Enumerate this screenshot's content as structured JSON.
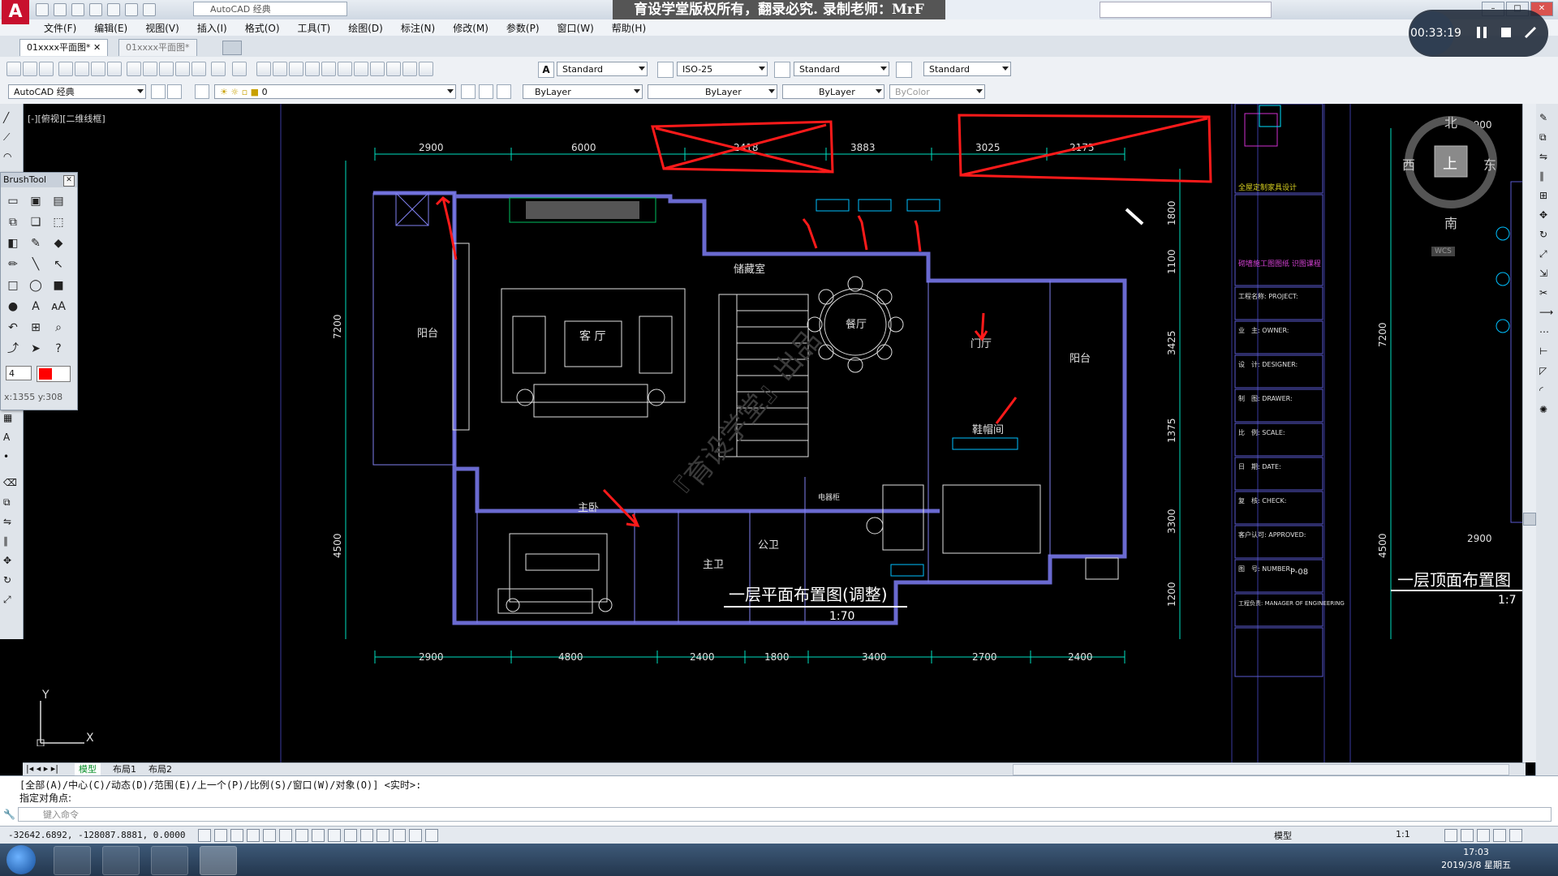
{
  "app": {
    "title_combo": "AutoCAD 经典",
    "banner": "育设学堂版权所有，翻录必究. 录制老师：MrF"
  },
  "menu": [
    "文件(F)",
    "编辑(E)",
    "视图(V)",
    "插入(I)",
    "格式(O)",
    "工具(T)",
    "绘图(D)",
    "标注(N)",
    "修改(M)",
    "参数(P)",
    "窗口(W)",
    "帮助(H)"
  ],
  "tabs": [
    "01xxxx平面图*",
    "01xxxx平面图*"
  ],
  "toolbar": {
    "text_style": "Standard",
    "dim_style": "ISO-25",
    "table_style": "Standard",
    "multileader_style": "Standard",
    "workspace": "AutoCAD 经典",
    "layer": "0",
    "color": "ByLayer",
    "linetype": "ByLayer",
    "lineweight": "ByLayer",
    "plotstyle": "ByColor"
  },
  "brushtool": {
    "title": "BrushTool",
    "size": "4",
    "color": "#ff0000",
    "coords": "x:1355 y:308"
  },
  "recorder": {
    "time": "00:33:19"
  },
  "viewport_label": "[-][俯视][二维线框]",
  "viewcube": {
    "north": "北",
    "south": "南",
    "east": "东",
    "west": "西",
    "top": "上",
    "wcs": "WCS"
  },
  "drawing": {
    "title1": "一层平面布置图(调整)",
    "scale1": "1:70",
    "title2": "一层顶面布置图",
    "scale2": "1:7",
    "top_dims": [
      "2900",
      "6000",
      "2418",
      "3883",
      "3025",
      "2175"
    ],
    "bottom_dims": [
      "2900",
      "4800",
      "2400",
      "1800",
      "3400",
      "2700",
      "2400"
    ],
    "left_dims": [
      "7200",
      "4500"
    ],
    "right_dims": [
      "1800",
      "1100",
      "3425",
      "1375",
      "3300",
      "1200"
    ],
    "right2_dims": [
      "2900",
      "7200",
      "4500",
      "2900"
    ],
    "rooms": {
      "balcony_left": "阳台",
      "living": "客 厅",
      "storage": "储藏室",
      "dining": "餐厅",
      "foyer": "门厅",
      "balcony_right": "阳台",
      "shoe": "鞋帽间",
      "master": "主卧",
      "master_bath": "主卫",
      "public_bath": "公卫",
      "appliance": "电器柜"
    },
    "watermark": "『育设学堂』出品"
  },
  "titleblock": [
    "全屋定制家具设计",
    "砌墙施工图图纸 识图课程",
    "工程名称: PROJECT:",
    "业　主: OWNER:",
    "设　计: DESIGNER:",
    "制　图: DRAWER:",
    "比　例: SCALE:",
    "日　期: DATE:",
    "复　核: CHECK:",
    "客户认可: APPROVED:",
    "图　号: NUMBER:",
    "工程负责: MANAGER OF ENGINEERING"
  ],
  "titleblock_number": "P-08",
  "layout_tabs": [
    "模型",
    "布局1",
    "布局2"
  ],
  "command": {
    "line1": "[全部(A)/中心(C)/动态(D)/范围(E)/上一个(P)/比例(S)/窗口(W)/对象(O)] <实时>:",
    "line2": "指定对角点:",
    "placeholder": "键入命令"
  },
  "status": {
    "coords": "-32642.6892, -128087.8881, 0.0000",
    "model": "模型",
    "scale": "1:1"
  },
  "clock": {
    "time": "17:03",
    "date": "2019/3/8 星期五"
  },
  "colors": {
    "accent_red": "#ff1a1a",
    "wall": "#6a6ad0",
    "dim": "#00e0c0",
    "furniture": "#e0e0e0"
  }
}
